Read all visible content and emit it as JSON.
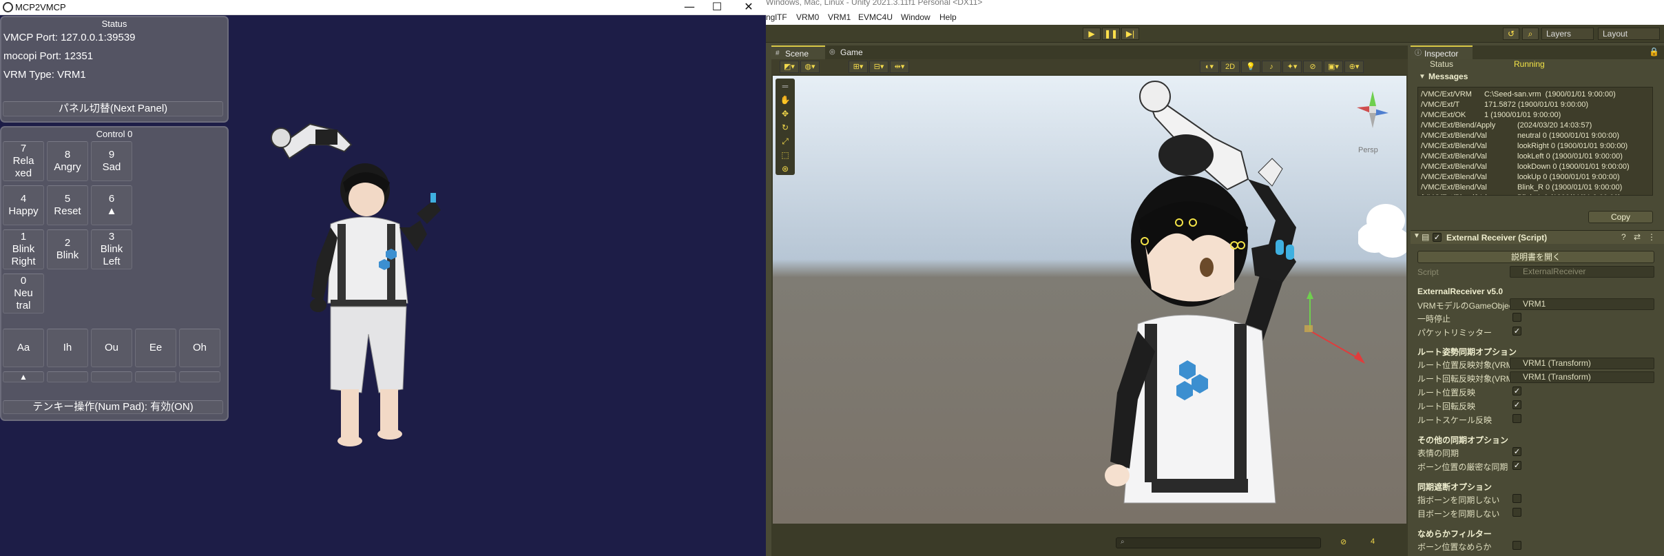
{
  "left_window": {
    "title": "MCP2VMCP",
    "status_panel": {
      "header": "Status",
      "vmcp_port": "VMCP Port: 127.0.0.1:39539",
      "mocopi_port": "mocopi Port: 12351",
      "vrm_type": "VRM Type: VRM1"
    },
    "panel_switch_button": "パネル切替(Next Panel)",
    "control_panel": {
      "header": "Control 0",
      "numpad": [
        {
          "key": "7",
          "label": "Rela\nxed"
        },
        {
          "key": "8",
          "label": "Angry"
        },
        {
          "key": "9",
          "label": "Sad"
        },
        {
          "key": "4",
          "label": "Happy"
        },
        {
          "key": "5",
          "label": "Reset"
        },
        {
          "key": "6",
          "label": "▲"
        },
        {
          "key": "1",
          "label": "Blink\nRight"
        },
        {
          "key": "2",
          "label": "Blink"
        },
        {
          "key": "3",
          "label": "Blink\nLeft"
        },
        {
          "key": "0",
          "label": "Neu\ntral"
        }
      ],
      "vowels": [
        "Aa",
        "Ih",
        "Ou",
        "Ee",
        "Oh"
      ],
      "vowel_arrow": "▲",
      "numpad_toggle": "テンキー操作(Num Pad): 有効(ON)"
    }
  },
  "unity": {
    "title": "Windows, Mac, Linux - Unity 2021.3.11f1 Personal <DX11>",
    "menu": [
      "nglTF",
      "VRM0",
      "VRM1",
      "EVMC4U",
      "Window",
      "Help"
    ],
    "toolbar": {
      "layers": "Layers",
      "layout": "Layout"
    },
    "scene_tabs": [
      "Scene",
      "Game"
    ],
    "scene_2d": "2D",
    "persp_label": "Persp",
    "scene_bottom_count": "4",
    "inspector": {
      "tab": "Inspector",
      "status_label": "Status",
      "status_value": "Running",
      "messages_header": "Messages",
      "messages": [
        {
          "addr": "/VMC/Ext/VRM",
          "val": "C:\\Seed-san.vrm  (1900/01/01 9:00:00)"
        },
        {
          "addr": "/VMC/Ext/T",
          "val": "171.5872 (1900/01/01 9:00:00)"
        },
        {
          "addr": "/VMC/Ext/OK",
          "val": "1 (1900/01/01 9:00:00)"
        },
        {
          "addr": "/VMC/Ext/Blend/Apply",
          "val": "(2024/03/20 14:03:57)"
        },
        {
          "addr": "/VMC/Ext/Blend/Val",
          "val": "neutral 0 (1900/01/01 9:00:00)"
        },
        {
          "addr": "/VMC/Ext/Blend/Val",
          "val": "lookRight 0 (1900/01/01 9:00:00)"
        },
        {
          "addr": "/VMC/Ext/Blend/Val",
          "val": "lookLeft 0 (1900/01/01 9:00:00)"
        },
        {
          "addr": "/VMC/Ext/Blend/Val",
          "val": "lookDown 0 (1900/01/01 9:00:00)"
        },
        {
          "addr": "/VMC/Ext/Blend/Val",
          "val": "lookUp 0 (1900/01/01 9:00:00)"
        },
        {
          "addr": "/VMC/Ext/Blend/Val",
          "val": "Blink_R 0 (1900/01/01 9:00:00)"
        },
        {
          "addr": "/VMC/Ext/Blend/Val",
          "val": "Blink_L 0 (1900/01/01 9:00:00)"
        }
      ],
      "copy_button": "Copy",
      "component_title": "External Receiver (Script)",
      "open_manual_button": "説明書を開く",
      "script_label": "Script",
      "script_value": "ExternalReceiver",
      "version_header": "ExternalReceiver v5.0",
      "vrm_model_label": "VRMモデルのGameObject",
      "vrm_model_value": "VRM1",
      "pause_label": "一時停止",
      "packet_limiter_label": "パケットリミッター",
      "root_sync_header": "ルート姿勢同期オプション",
      "root_pos_target_label": "ルート位置反映対象(VRM",
      "root_pos_target_value": "VRM1 (Transform)",
      "root_rot_target_label": "ルート回転反映対象(VRM",
      "root_rot_target_value": "VRM1 (Transform)",
      "root_pos_label": "ルート位置反映",
      "root_rot_label": "ルート回転反映",
      "root_scale_label": "ルートスケール反映",
      "other_sync_header": "その他の同期オプション",
      "expression_sync_label": "表情の同期",
      "bone_pos_sync_label": "ボーン位置の厳密な同期",
      "sync_cut_header": "同期遮断オプション",
      "finger_bone_label": "指ボーンを同期しない",
      "eye_bone_label": "目ボーンを同期しない",
      "smooth_header": "なめらかフィルター",
      "bone_pos_smooth_label": "ボーン位置なめらか"
    }
  }
}
